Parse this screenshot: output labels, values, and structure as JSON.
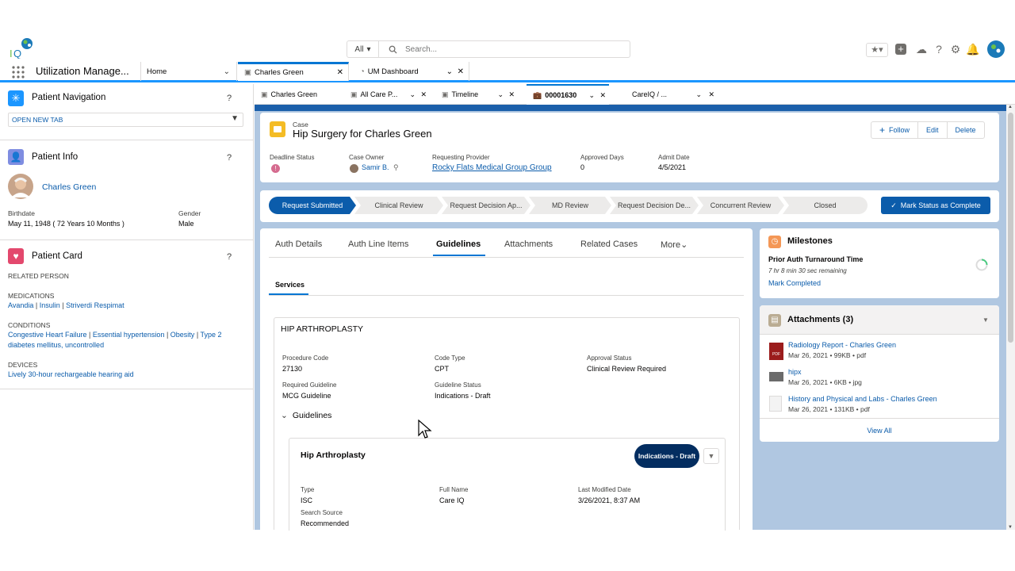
{
  "header": {
    "search_scope": "All",
    "search_placeholder": "Search..."
  },
  "nav": {
    "app_name": "Utilization Manage...",
    "tabs": [
      {
        "label": "Home"
      },
      {
        "label": "Charles Green"
      },
      {
        "label": "UM Dashboard"
      }
    ]
  },
  "left": {
    "nav_title": "Patient Navigation",
    "open_new_tab": "OPEN NEW TAB",
    "info_title": "Patient Info",
    "patient_name": "Charles Green",
    "birthdate_label": "Birthdate",
    "birthdate": "May 11, 1948 ( 72 Years 10 Months )",
    "gender_label": "Gender",
    "gender": "Male",
    "card_title": "Patient Card",
    "related_person": "RELATED PERSON",
    "medications_label": "MEDICATIONS",
    "medications": [
      "Avandia",
      "Insulin",
      "Striverdi Respimat"
    ],
    "conditions_label": "CONDITIONS",
    "conditions_line1": [
      "Congestive Heart Failure",
      "Essential hypertension",
      "Obesity",
      "Type 2"
    ],
    "conditions_line2": "diabetes mellitus, uncontrolled",
    "devices_label": "DEVICES",
    "device": "Lively 30-hour rechargeable hearing aid",
    "q": "?"
  },
  "subtabs": [
    {
      "label": "Charles Green"
    },
    {
      "label": "All Care P..."
    },
    {
      "label": "Timeline"
    },
    {
      "label": "00001630"
    },
    {
      "label": "CareIQ / ..."
    }
  ],
  "case": {
    "type": "Case",
    "title": "Hip Surgery for Charles Green",
    "follow": "Follow",
    "edit": "Edit",
    "delete": "Delete",
    "deadline_label": "Deadline Status",
    "owner_label": "Case Owner",
    "owner": "Samir B.",
    "provider_label": "Requesting Provider",
    "provider": "Rocky Flats Medical Group Group",
    "approved_label": "Approved Days",
    "approved": "0",
    "admit_label": "Admit Date",
    "admit": "4/5/2021"
  },
  "path": {
    "steps": [
      "Request Submitted",
      "Clinical Review",
      "Request Decision Ap...",
      "MD Review",
      "Request Decision De...",
      "Concurrent Review",
      "Closed"
    ],
    "complete_button": "Mark Status as Complete"
  },
  "record_tabs": [
    "Auth Details",
    "Auth Line Items",
    "Guidelines",
    "Attachments",
    "Related Cases",
    "More"
  ],
  "services_tab": "Services",
  "procedure": {
    "title": "HIP ARTHROPLASTY",
    "code_label": "Procedure Code",
    "code": "27130",
    "type_label": "Code Type",
    "type": "CPT",
    "approval_label": "Approval Status",
    "approval": "Clinical Review Required",
    "req_label": "Required Guideline",
    "req": "MCG Guideline",
    "gstatus_label": "Guideline Status",
    "gstatus": "Indications - Draft",
    "guidelines_toggle": "Guidelines"
  },
  "guideline": {
    "title": "Hip Arthroplasty",
    "badge": "Indications - Draft",
    "type_label": "Type",
    "type": "ISC",
    "full_label": "Full Name",
    "full": "Care IQ",
    "mod_label": "Last Modified Date",
    "mod": "3/26/2021, 8:37 AM",
    "src_label": "Search Source",
    "src": "Recommended"
  },
  "milestones": {
    "title": "Milestones",
    "name": "Prior Auth Turnaround Time",
    "remaining": "7 hr 8 min 30 sec remaining",
    "mark": "Mark Completed"
  },
  "attachments": {
    "title": "Attachments (3)",
    "items": [
      {
        "name": "Radiology Report - Charles Green",
        "meta": "Mar 26, 2021 • 99KB • pdf"
      },
      {
        "name": "hipx",
        "meta": "Mar 26, 2021 • 6KB • jpg"
      },
      {
        "name": "History and Physical and Labs - Charles Green",
        "meta": "Mar 26, 2021 • 131KB • pdf"
      }
    ],
    "view_all": "View All"
  },
  "colors": {
    "accent": "#0176d3",
    "brand_dark": "#0b5cab",
    "badge": "#032d60"
  }
}
